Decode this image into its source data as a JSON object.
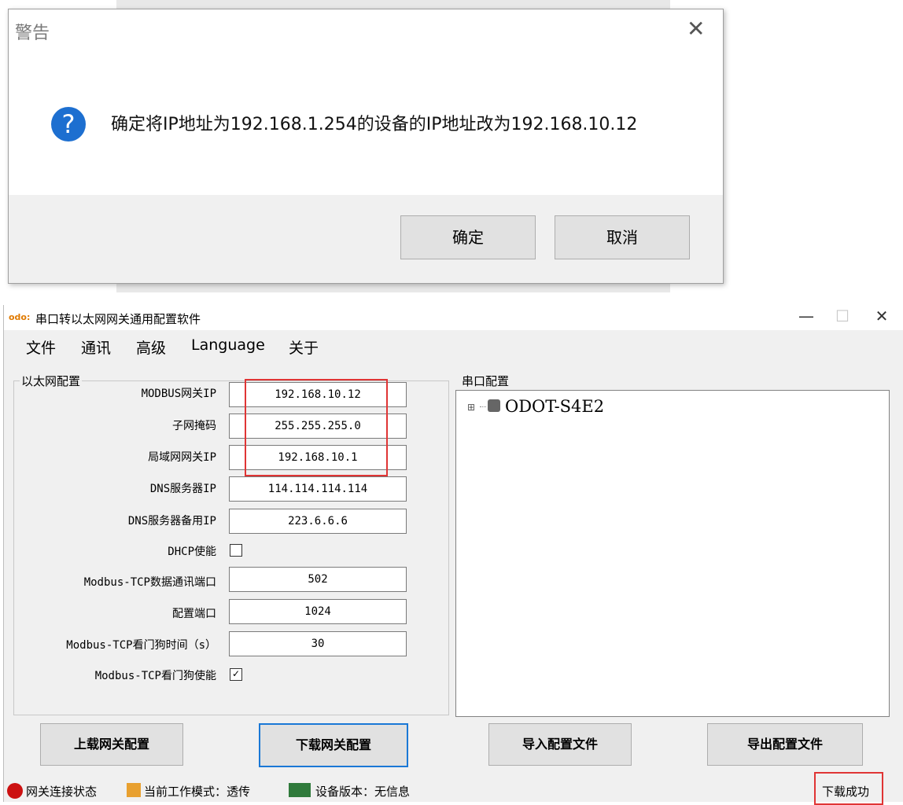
{
  "dialog": {
    "title": "警告",
    "close_glyph": "✕",
    "question_glyph": "?",
    "message": "确定将IP地址为192.168.1.254的设备的IP地址改为192.168.10.12",
    "ok_label": "确定",
    "cancel_label": "取消"
  },
  "window": {
    "title": "串口转以太网网关通用配置软件",
    "icon_text": "odo:",
    "minimize_glyph": "—",
    "maximize_glyph": "☐",
    "close_glyph": "✕"
  },
  "menu": [
    "文件",
    "通讯",
    "高级",
    "Language",
    "关于"
  ],
  "ethernet": {
    "group_label": "以太网配置",
    "fields": [
      {
        "label": "MODBUS网关IP",
        "value": "192.168.10.12"
      },
      {
        "label": "子网掩码",
        "value": "255.255.255.0"
      },
      {
        "label": "局域网网关IP",
        "value": "192.168.10.1"
      },
      {
        "label": "DNS服务器IP",
        "value": "114.114.114.114"
      },
      {
        "label": "DNS服务器备用IP",
        "value": "223.6.6.6"
      }
    ],
    "dhcp_label": "DHCP使能",
    "dhcp_checked": false,
    "tcp_fields": [
      {
        "label": "Modbus-TCP数据通讯端口",
        "value": "502"
      },
      {
        "label": "配置端口",
        "value": "1024"
      },
      {
        "label": "Modbus-TCP看门狗时间（s）",
        "value": "30"
      }
    ],
    "watchdog_label": "Modbus-TCP看门狗使能",
    "watchdog_checked": true,
    "check_glyph": "✓"
  },
  "serial": {
    "group_label": "串口配置",
    "tree_root": "ODOT-S4E2",
    "expand_glyph": "⊞"
  },
  "buttons": {
    "upload": "上载网关配置",
    "download": "下载网关配置",
    "import": "导入配置文件",
    "export": "导出配置文件"
  },
  "status": {
    "connection": "网关连接状态",
    "mode": "当前工作模式：透传",
    "version": "设备版本：无信息",
    "result": "下载成功"
  },
  "colors": {
    "highlight_box": "#e03535",
    "status_connected_dot": "#cc1111",
    "question_icon": "#1d6fd0"
  }
}
